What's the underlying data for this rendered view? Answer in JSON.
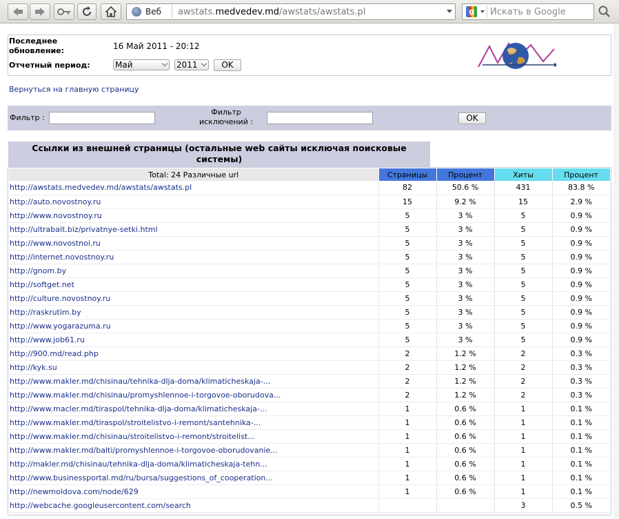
{
  "browser": {
    "site_label": "Веб",
    "url_prefix": "awstats.",
    "url_domain": "medvedev.md",
    "url_path": "/awstats/awstats.pl",
    "search_placeholder": "Искать в Google",
    "search_engine_icon": "google-icon"
  },
  "info": {
    "last_update_label": "Последнее обновление:",
    "last_update_value": "16 Май 2011 - 20:12",
    "period_label": "Отчетный период:",
    "month_selected": "Май",
    "year_selected": "2011",
    "ok_label": "OK"
  },
  "back_link": "Вернуться на главную страницу",
  "filter": {
    "filter_label": "Фильтр :",
    "exclude_label_line1": "Фильтр",
    "exclude_label_line2": "исключений :",
    "ok_label": "OK"
  },
  "table": {
    "title": "Ссылки из внешней страницы (остальные web сайты исключая поисковые системы)",
    "headers": {
      "total": "Total: 24 Различные url",
      "pages": "Страницы",
      "pages_pct": "Процент",
      "hits": "Хиты",
      "hits_pct": "Процент"
    },
    "rows": [
      {
        "url": "http://awstats.medvedev.md/awstats/awstats.pl",
        "pages": "82",
        "pages_pct": "50.6 %",
        "hits": "431",
        "hits_pct": "83.8 %"
      },
      {
        "url": "http://auto.novostnoy.ru",
        "pages": "15",
        "pages_pct": "9.2 %",
        "hits": "15",
        "hits_pct": "2.9 %"
      },
      {
        "url": "http://www.novostnoy.ru",
        "pages": "5",
        "pages_pct": "3 %",
        "hits": "5",
        "hits_pct": "0.9 %"
      },
      {
        "url": "http://ultrabait.biz/privatnye-setki.html",
        "pages": "5",
        "pages_pct": "3 %",
        "hits": "5",
        "hits_pct": "0.9 %"
      },
      {
        "url": "http://www.novostnoi.ru",
        "pages": "5",
        "pages_pct": "3 %",
        "hits": "5",
        "hits_pct": "0.9 %"
      },
      {
        "url": "http://internet.novostnoy.ru",
        "pages": "5",
        "pages_pct": "3 %",
        "hits": "5",
        "hits_pct": "0.9 %"
      },
      {
        "url": "http://gnom.by",
        "pages": "5",
        "pages_pct": "3 %",
        "hits": "5",
        "hits_pct": "0.9 %"
      },
      {
        "url": "http://softget.net",
        "pages": "5",
        "pages_pct": "3 %",
        "hits": "5",
        "hits_pct": "0.9 %"
      },
      {
        "url": "http://culture.novostnoy.ru",
        "pages": "5",
        "pages_pct": "3 %",
        "hits": "5",
        "hits_pct": "0.9 %"
      },
      {
        "url": "http://raskrutim.by",
        "pages": "5",
        "pages_pct": "3 %",
        "hits": "5",
        "hits_pct": "0.9 %"
      },
      {
        "url": "http://www.yogarazuma.ru",
        "pages": "5",
        "pages_pct": "3 %",
        "hits": "5",
        "hits_pct": "0.9 %"
      },
      {
        "url": "http://www.job61.ru",
        "pages": "5",
        "pages_pct": "3 %",
        "hits": "5",
        "hits_pct": "0.9 %"
      },
      {
        "url": "http://900.md/read.php",
        "pages": "2",
        "pages_pct": "1.2 %",
        "hits": "2",
        "hits_pct": "0.3 %"
      },
      {
        "url": "http://kyk.su",
        "pages": "2",
        "pages_pct": "1.2 %",
        "hits": "2",
        "hits_pct": "0.3 %"
      },
      {
        "url": "http://www.makler.md/chisinau/tehnika-dlja-doma/klimaticheskaja-...",
        "pages": "2",
        "pages_pct": "1.2 %",
        "hits": "2",
        "hits_pct": "0.3 %"
      },
      {
        "url": "http://www.makler.md/chisinau/promyshlennoe-i-torgovoe-oborudova...",
        "pages": "2",
        "pages_pct": "1.2 %",
        "hits": "2",
        "hits_pct": "0.3 %"
      },
      {
        "url": "http://www.macler.md/tiraspol/tehnika-dlja-doma/klimaticheskaja-...",
        "pages": "1",
        "pages_pct": "0.6 %",
        "hits": "1",
        "hits_pct": "0.1 %"
      },
      {
        "url": "http://www.makler.md/tiraspol/stroitelistvo-i-remont/santehnika-...",
        "pages": "1",
        "pages_pct": "0.6 %",
        "hits": "1",
        "hits_pct": "0.1 %"
      },
      {
        "url": "http://www.makler.md/chisinau/stroitelistvo-i-remont/stroitelist...",
        "pages": "1",
        "pages_pct": "0.6 %",
        "hits": "1",
        "hits_pct": "0.1 %"
      },
      {
        "url": "http://www.makler.md/balti/promyshlennoe-i-torgovoe-oborudovanie...",
        "pages": "1",
        "pages_pct": "0.6 %",
        "hits": "1",
        "hits_pct": "0.1 %"
      },
      {
        "url": "http://makler.md/chisinau/tehnika-dlja-doma/klimaticheskaja-tehn...",
        "pages": "1",
        "pages_pct": "0.6 %",
        "hits": "1",
        "hits_pct": "0.1 %"
      },
      {
        "url": "http://www.businessportal.md/ru/bursa/suggestions_of_cooperation...",
        "pages": "1",
        "pages_pct": "0.6 %",
        "hits": "1",
        "hits_pct": "0.1 %"
      },
      {
        "url": "http://newmoldova.com/node/629",
        "pages": "1",
        "pages_pct": "0.6 %",
        "hits": "1",
        "hits_pct": "0.1 %"
      },
      {
        "url": "http://webcache.googleusercontent.com/search",
        "pages": "",
        "pages_pct": "",
        "hits": "3",
        "hits_pct": "0.5 %"
      }
    ]
  }
}
